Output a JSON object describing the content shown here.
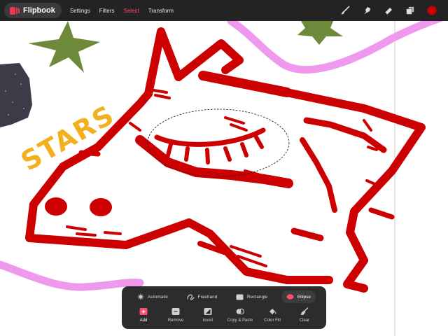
{
  "app": {
    "name": "Flipbook"
  },
  "menu": {
    "items": [
      "Settings",
      "Filters",
      "Select",
      "Transform"
    ],
    "active": "Select"
  },
  "tools": {
    "icons": [
      "brush-icon",
      "smudge-icon",
      "eraser-icon",
      "layers-icon",
      "color-swatch-icon"
    ],
    "current_color": "#cc0000"
  },
  "canvas": {
    "text": "STARS"
  },
  "selection_panel": {
    "modes": [
      {
        "label": "Automatic",
        "icon": "automatic-icon"
      },
      {
        "label": "Freehand",
        "icon": "freehand-icon"
      },
      {
        "label": "Rectangle",
        "icon": "rectangle-icon"
      },
      {
        "label": "Ellipse",
        "icon": "ellipse-icon"
      }
    ],
    "active_mode": "Ellipse",
    "actions": [
      {
        "label": "Add",
        "icon": "add-icon"
      },
      {
        "label": "Remove",
        "icon": "remove-icon"
      },
      {
        "label": "Invert",
        "icon": "invert-icon"
      },
      {
        "label": "Copy & Paste",
        "icon": "copy-paste-icon"
      },
      {
        "label": "Color Fill",
        "icon": "color-fill-icon"
      },
      {
        "label": "Clear",
        "icon": "clear-icon"
      }
    ],
    "active_action": "Add"
  },
  "colors": {
    "accent": "#ff4d6d",
    "ink": "#cc0000",
    "star": "#6d8a3a",
    "stars_text": "#f2b01e",
    "pink": "#ee98ee",
    "rock": "#3c3c48"
  }
}
